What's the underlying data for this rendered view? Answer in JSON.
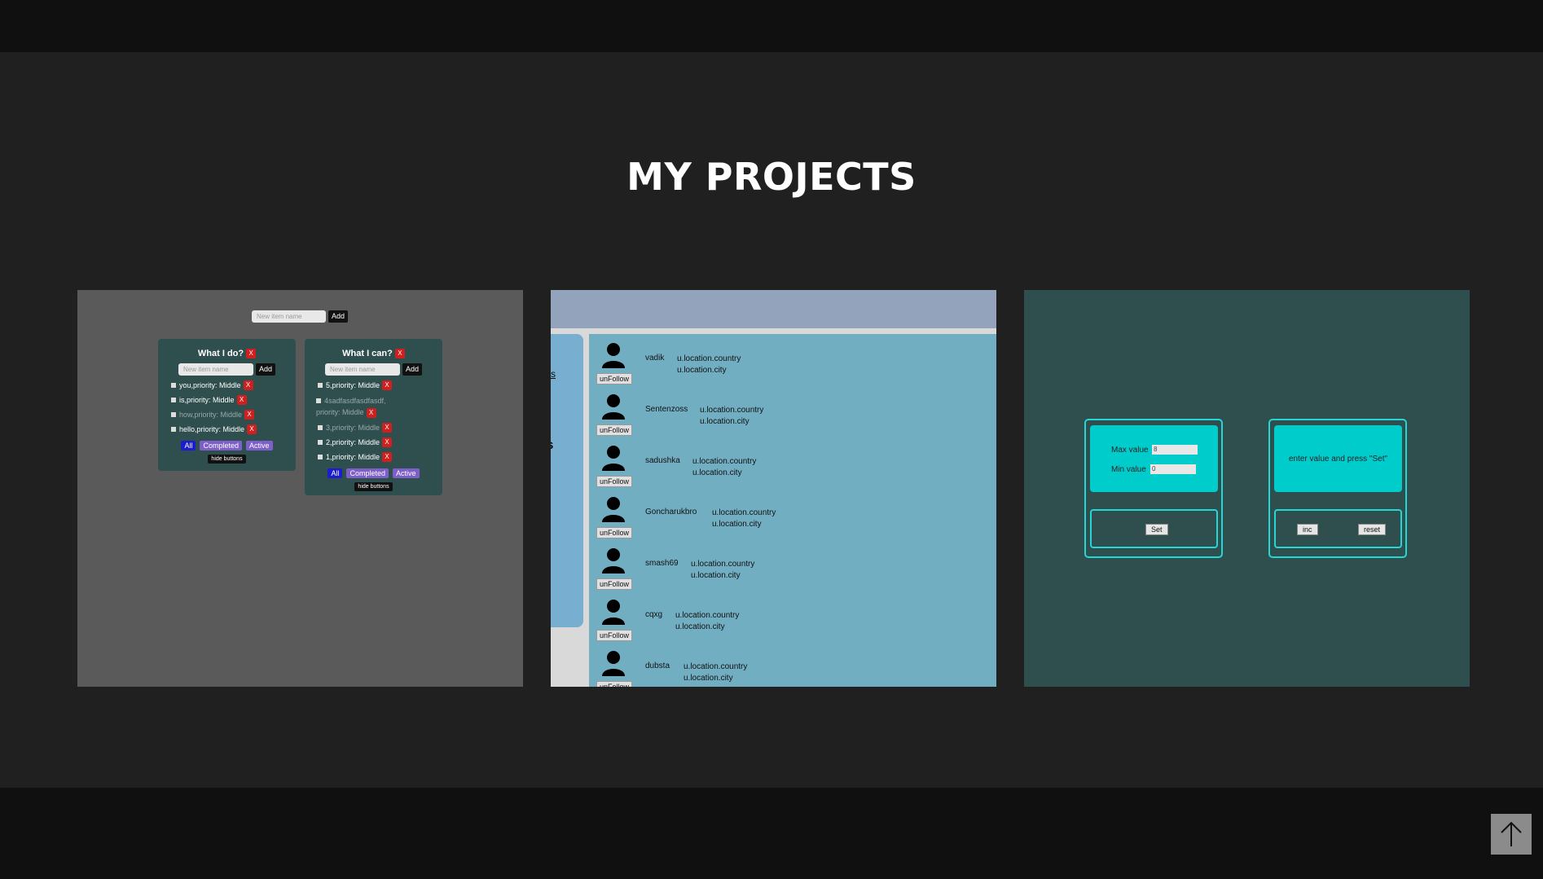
{
  "page": {
    "title": "MY PROJECTS"
  },
  "projects": [
    {
      "new_item_placeholder": "New item name",
      "add_label": "Add",
      "lists": [
        {
          "title": "What I do?",
          "remove_label": "X",
          "placeholder": "New item name",
          "add_label": "Add",
          "tasks": [
            {
              "text": "you,priority: Middle",
              "done": false
            },
            {
              "text": "is,priority: Middle",
              "done": false
            },
            {
              "text": "how,priority: Middle",
              "done": true
            },
            {
              "text": "hello,priority: Middle",
              "done": false
            }
          ],
          "filters": [
            "All",
            "Completed",
            "Active"
          ],
          "hide_label": "hide buttons"
        },
        {
          "title": "What I can?",
          "remove_label": "X",
          "placeholder": "New item name",
          "add_label": "Add",
          "tasks": [
            {
              "text": "5,priority: Middle",
              "done": false
            },
            {
              "text": "4sadfasdfasdfasdf, priority: Middle",
              "done": true
            },
            {
              "text": "3,priority: Middle",
              "done": true
            },
            {
              "text": "2,priority: Middle",
              "done": false
            },
            {
              "text": "1,priority: Middle",
              "done": false
            }
          ],
          "filters": [
            "All",
            "Completed",
            "Active"
          ],
          "hide_label": "hide buttons"
        }
      ]
    },
    {
      "sidebar_fragments": [
        "s",
        "ls"
      ],
      "follow_label": "unFollow",
      "country_label": "u.location.country",
      "city_label": "u.location.city",
      "users": [
        "vadik",
        "Sentenzoss",
        "sadushka",
        "Goncharukbro",
        "smash69",
        "cqxg",
        "dubsta"
      ]
    },
    {
      "max_label": "Max value",
      "min_label": "Min value",
      "max_value": "8",
      "min_value": "0",
      "set_label": "Set",
      "message": "enter value and press \"Set\"",
      "inc_label": "inc",
      "reset_label": "reset"
    }
  ],
  "scroll_top": {
    "icon": "arrow-up-icon"
  },
  "colors": {
    "background": "#202020",
    "bars": "#101010",
    "todo_card": "#5a5a5a",
    "users_list": "#72aec2",
    "counter_bg": "#2f4f4f",
    "counter_accent": "#00cccc",
    "danger": "#d01f1f"
  }
}
